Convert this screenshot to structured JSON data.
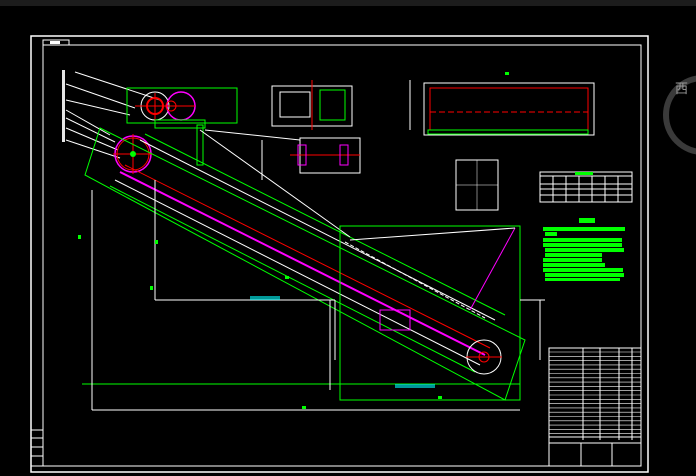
{
  "app": {
    "type": "CAD drawing viewer"
  },
  "viewcube": {
    "direction_label": "西",
    "ring_color": "#3a3a3a"
  },
  "colors": {
    "background": "#000000",
    "frame": "#ffffff",
    "green": "#00ff00",
    "red": "#ff0000",
    "magenta": "#ff00ff",
    "cyan": "#00ffff"
  }
}
